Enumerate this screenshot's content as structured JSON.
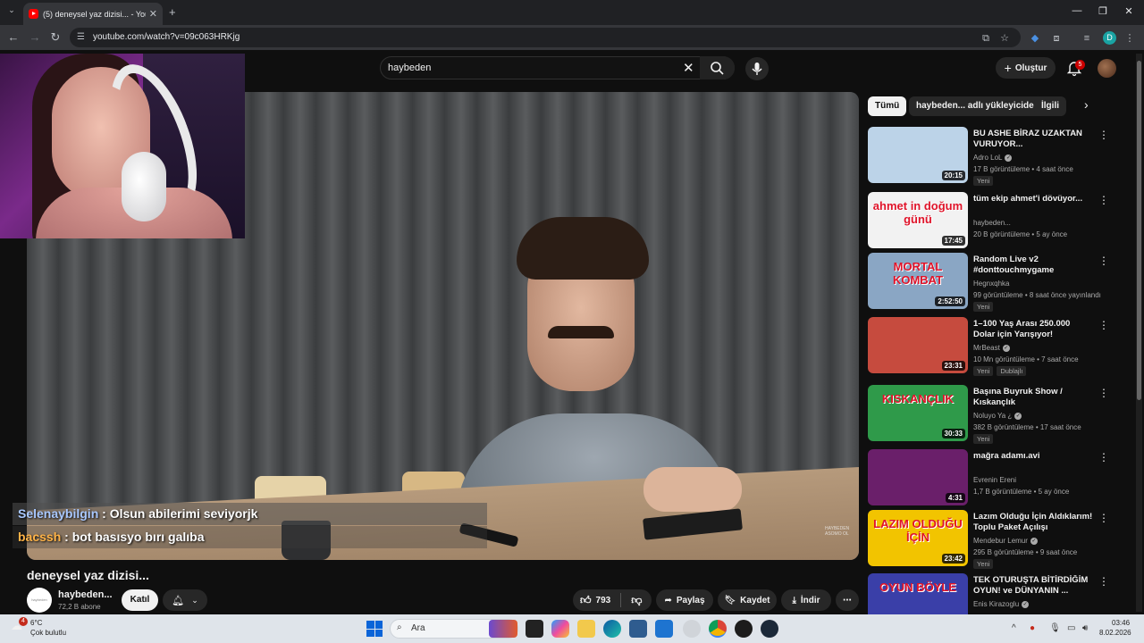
{
  "browser": {
    "tab_title": "(5) deneysel yaz dizisi... - YouTube",
    "url": "youtube.com/watch?v=09c063HRKjg",
    "profile_initial": "D"
  },
  "youtube": {
    "search_value": "haybeden",
    "create_label": "Oluştur",
    "notifications_count": "5"
  },
  "chat": [
    {
      "user": "Selenaybilgin",
      "user_color": "#a9c8ff",
      "message": " : Olsun abilerimi seviyorjk"
    },
    {
      "user": "bacssh",
      "user_color": "#ffb347",
      "message": " : bot basısyo bırı galıba"
    }
  ],
  "video": {
    "title": "deneysel yaz dizisi...",
    "channel": "haybeden...",
    "channel_avatar_text": "haybeden",
    "subscribers": "72,2 B abone",
    "join_label": "Katıl",
    "likes": "793",
    "share_label": "Paylaş",
    "save_label": "Kaydet",
    "download_label": "İndir",
    "watermark": "HAYBEDEN ASOMO OL"
  },
  "chips": [
    "Tümü",
    "haybeden... adlı yükleyiciden",
    "İlgili"
  ],
  "recommendations": [
    {
      "title": "BU ASHE BİRAZ UZAKTAN VURUYOR...",
      "channel": "Adro LoL",
      "verified": true,
      "meta": "17 B görüntüleme • 4 saat önce",
      "badges": [
        "Yeni"
      ],
      "duration": "20:15",
      "thumb_color": "#bcd3e8"
    },
    {
      "title": "tüm ekip ahmet'i dövüyor...",
      "channel": "haybeden...",
      "verified": false,
      "meta": "20 B görüntüleme • 5 ay önce",
      "badges": [],
      "duration": "17:45",
      "thumb_color": "#f2f2f2",
      "thumb_text": "ahmet in doğum günü"
    },
    {
      "title": "Random Live v2 #donttouchmygame",
      "channel": "Hegnxqhka",
      "verified": false,
      "meta": "99 görüntüleme • 8 saat önce yayınlandı",
      "badges": [
        "Yeni"
      ],
      "duration": "2:52:50",
      "thumb_color": "#8aa6c4",
      "thumb_text": "MORTAL KOMBAT"
    },
    {
      "title": "1–100 Yaş Arası 250.000 Dolar için Yarışıyor!",
      "channel": "MrBeast",
      "verified": true,
      "meta": "10 Mn görüntüleme • 7 saat önce",
      "badges": [
        "Yeni",
        "Dublajlı"
      ],
      "duration": "23:31",
      "thumb_color": "#c64b3e"
    },
    {
      "title": "Başına Buyruk Show / Kıskançlık",
      "channel": "Noluyo Ya ¿",
      "verified": true,
      "meta": "382 B görüntüleme • 17 saat önce",
      "badges": [
        "Yeni"
      ],
      "duration": "30:33",
      "thumb_color": "#2f9a4a",
      "thumb_text": "KISKANÇLIK"
    },
    {
      "title": "mağra adamı.avi",
      "channel": "Evrenin Ereni",
      "verified": false,
      "meta": "1,7 B görüntüleme • 5 ay önce",
      "badges": [],
      "duration": "4:31",
      "thumb_color": "#6a1f6a"
    },
    {
      "title": "Lazım Olduğu İçin Aldıklarım! Toplu Paket Açılışı",
      "channel": "Mendebur Lemur",
      "verified": true,
      "meta": "295 B görüntüleme • 9 saat önce",
      "badges": [
        "Yeni"
      ],
      "duration": "23:42",
      "thumb_color": "#f2c400",
      "thumb_text": "LAZIM OLDUĞU İÇİN"
    },
    {
      "title": "TEK OTURUŞTA BİTİRDİĞİM OYUN! ve DÜNYANIN ...",
      "channel": "Enis Kirazoglu",
      "verified": true,
      "meta": "",
      "badges": [],
      "duration": "",
      "thumb_color": "#3a3fa8",
      "thumb_text": "OYUN BÖYLE"
    }
  ],
  "taskbar": {
    "weather_temp": "6°C",
    "weather_desc": "Çok bulutlu",
    "weather_badge": "4",
    "search_placeholder": "Ara",
    "time": "03:46",
    "date": "8.02.2026"
  }
}
